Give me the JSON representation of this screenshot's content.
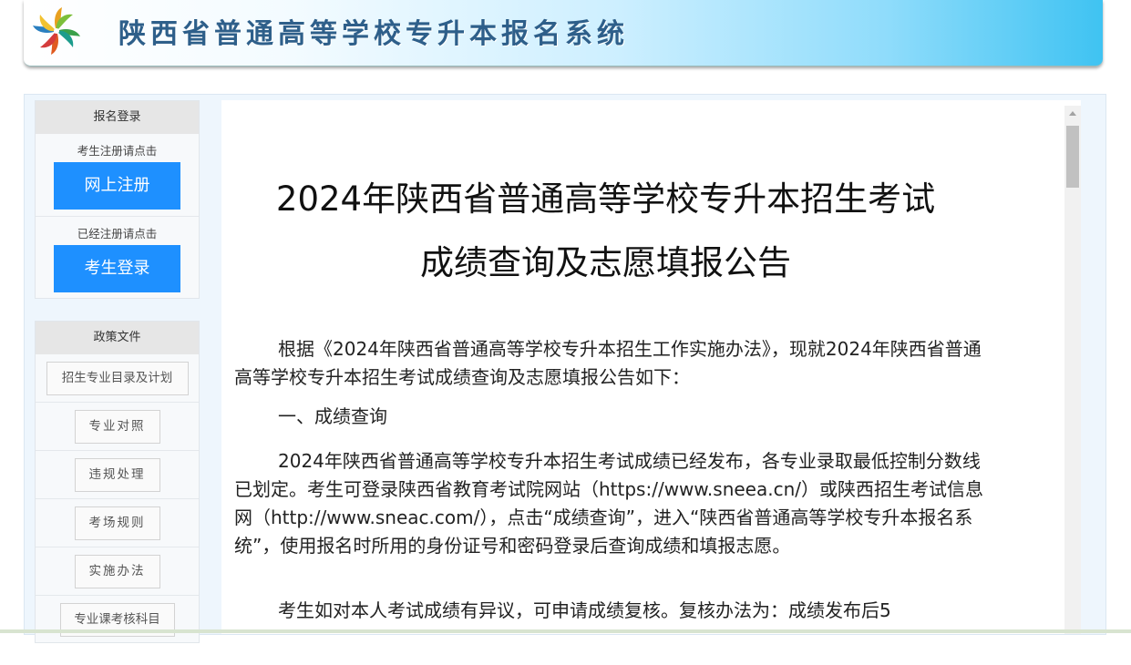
{
  "header": {
    "site_title": "陕西省普通高等学校专升本报名系统",
    "logo_icon": "pinwheel-logo-icon"
  },
  "sidebar": {
    "login_box": {
      "heading": "报名登录",
      "register_hint": "考生注册请点击",
      "register_button": "网上注册",
      "login_hint": "已经注册请点击",
      "login_button": "考生登录"
    },
    "policy_box": {
      "heading": "政策文件",
      "links": [
        "招生专业目录及计划",
        "专业对照",
        "违规处理",
        "考场规则",
        "实施办法",
        "专业课考核科目"
      ]
    }
  },
  "content": {
    "title_line1": "2024年陕西省普通高等学校专升本招生考试",
    "title_line2": "成绩查询及志愿填报公告",
    "paragraph1": "根据《2024年陕西省普通高等学校专升本招生工作实施办法》，现就2024年陕西省普通高等学校专升本招生考试成绩查询及志愿填报公告如下：",
    "section1_heading": "一、成绩查询",
    "paragraph2": "2024年陕西省普通高等学校专升本招生考试成绩已经发布，各专业录取最低控制分数线已划定。考生可登录陕西省教育考试院网站（https://www.sneea.cn/）或陕西招生考试信息网（http://www.sneac.com/），点击“成绩查询”，进入“陕西省普通高等学校专升本报名系统”，使用报名时所用的身份证号和密码登录后查询成绩和填报志愿。",
    "paragraph3": "考生如对本人考试成绩有异议，可申请成绩复核。复核办法为：成绩发布后5"
  },
  "colors": {
    "accent_button": "#1e90ff",
    "banner_end": "#3fc3f2",
    "title_text": "#2e5f8a"
  }
}
